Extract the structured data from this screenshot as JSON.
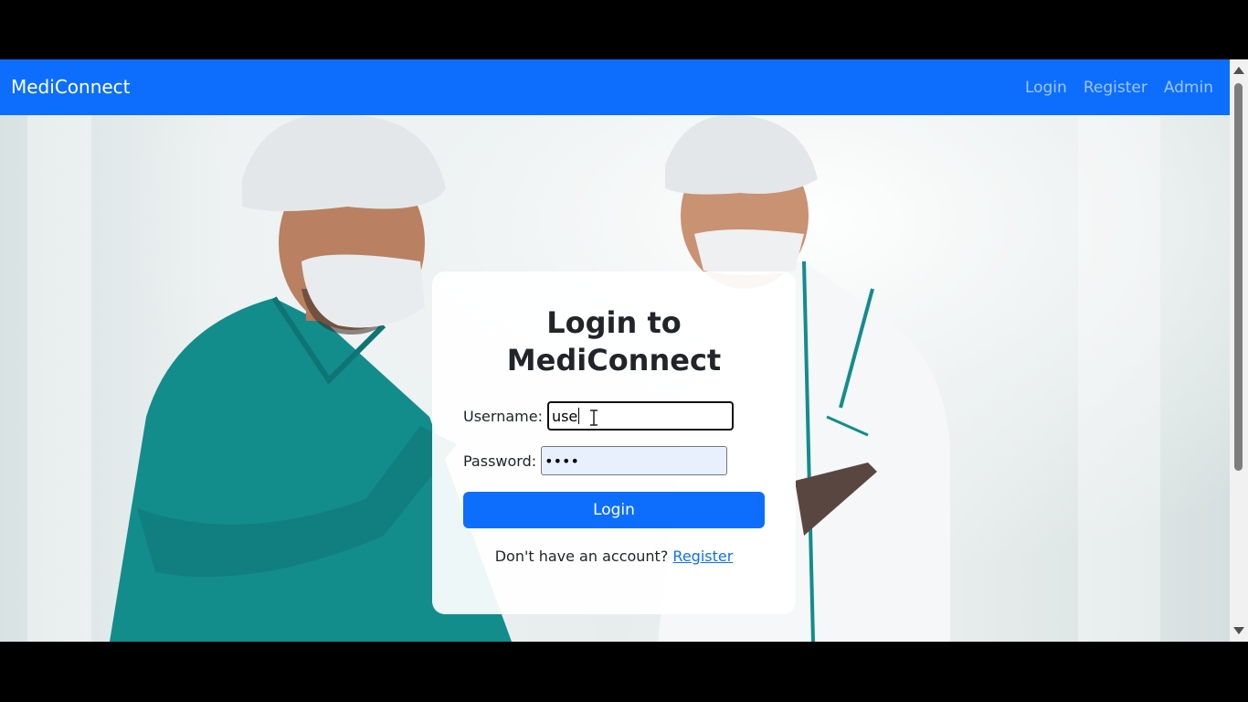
{
  "navbar": {
    "brand": "MediConnect",
    "links": [
      "Login",
      "Register",
      "Admin"
    ]
  },
  "login_card": {
    "title_line1": "Login to",
    "title_line2": "MediConnect",
    "username_label": "Username:",
    "username_value": "use",
    "password_label": "Password:",
    "password_value": "••••",
    "login_button": "Login",
    "register_prompt": "Don't have an account?",
    "register_link": "Register"
  },
  "colors": {
    "primary": "#0d6efd",
    "scrub_teal": "#138c8c",
    "autofill_bg": "#e8f0fe"
  },
  "hero_image": "medical-staff-photo"
}
